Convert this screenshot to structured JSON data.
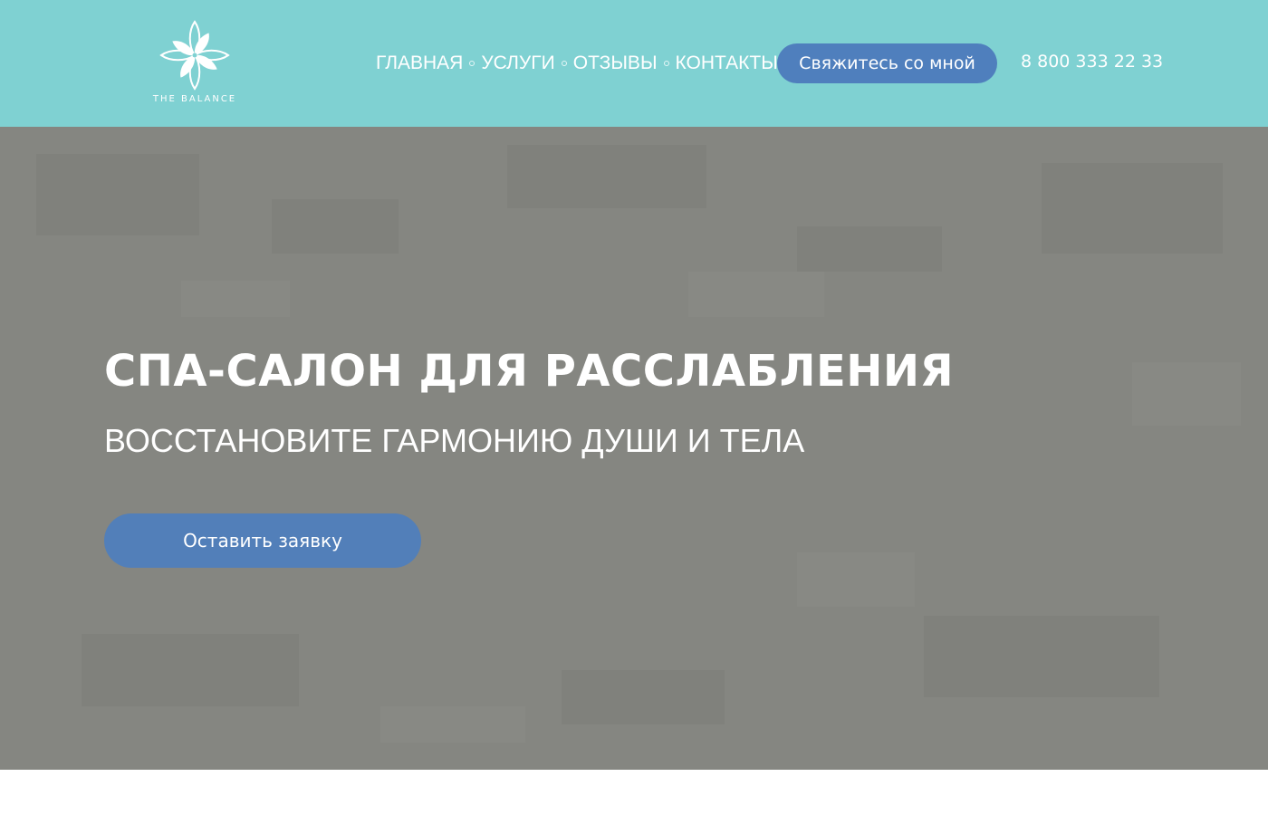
{
  "header": {
    "background": "#7fd1d2",
    "logo": {
      "icon": "flower-logo-icon",
      "text": "THE BALANCE"
    },
    "nav": [
      {
        "label": "ГЛАВНАЯ"
      },
      {
        "label": "УСЛУГИ"
      },
      {
        "label": "ОТЗЫВЫ"
      },
      {
        "label": "КОНТАКТЫ"
      }
    ],
    "contact_button": "Свяжитесь со мной",
    "phone": "8 800 333 22 33"
  },
  "hero": {
    "background": "#858681",
    "title": "СПА-САЛОН ДЛЯ РАССЛАБЛЕНИЯ",
    "subtitle": "ВОССТАНОВИТЕ ГАРМОНИЮ ДУШИ И ТЕЛА",
    "cta": "Оставить заявку"
  },
  "colors": {
    "accent": "#4f7fbd",
    "header_bg": "#7fd1d2",
    "text_light": "#ffffff"
  }
}
